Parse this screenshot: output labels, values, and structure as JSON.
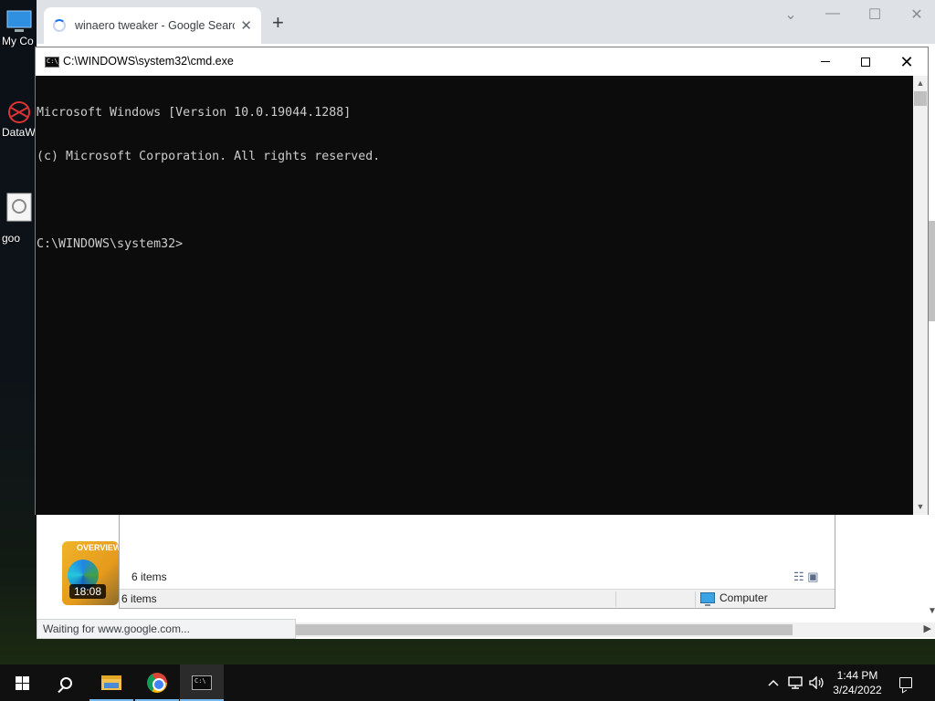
{
  "desktop": {
    "icons": [
      {
        "label": "My Co",
        "icon": "computer-icon"
      },
      {
        "label": "DataW",
        "icon": "datawrapper-icon"
      },
      {
        "label": "goo",
        "icon": "image-file-icon"
      }
    ]
  },
  "chrome": {
    "tab_title": "winaero tweaker - Google Search",
    "tab_close": "✕",
    "new_tab": "+",
    "status_text": "Waiting for www.google.com...",
    "video_duration": "18:08",
    "video_overlay": "OVERVIEW"
  },
  "explorer": {
    "items_count": "6 items",
    "status_items": "6 items",
    "status_location": "Computer"
  },
  "cmd": {
    "title": "C:\\WINDOWS\\system32\\cmd.exe",
    "lines": [
      "Microsoft Windows [Version 10.0.19044.1288]",
      "(c) Microsoft Corporation. All rights reserved.",
      "",
      "C:\\WINDOWS\\system32>"
    ],
    "colors": {
      "background": "#0c0c0c",
      "text": "#cccccc"
    }
  },
  "taskbar": {
    "time": "1:44 PM",
    "date": "3/24/2022",
    "apps": [
      "start-icon",
      "search-icon",
      "file-explorer-icon",
      "chrome-icon",
      "command-prompt-icon"
    ],
    "active_app": "command-prompt-icon",
    "accent": "#76b9ed"
  }
}
